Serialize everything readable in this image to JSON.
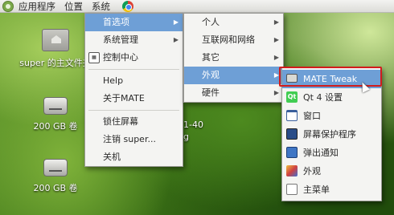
{
  "panel": {
    "menus": [
      "应用程序",
      "位置",
      "系统"
    ],
    "icons": {
      "logo": "mate-logo",
      "browser": "chrome-icon"
    }
  },
  "desktop": {
    "home_icon_label": "super 的主文件夹",
    "disk1_label": "200 GB 卷",
    "disk2_label": "200 GB 卷",
    "bg_fragment_1": "1-40",
    "bg_fragment_2": "g"
  },
  "system_menu": {
    "items": [
      {
        "label": "首选项",
        "has_submenu": true,
        "active": true
      },
      {
        "label": "系统管理",
        "has_submenu": true
      },
      {
        "label": "控制中心",
        "icon": "control-center-icon"
      },
      {
        "label": "Help"
      },
      {
        "label": "关于MATE"
      },
      {
        "label": "锁住屏幕"
      },
      {
        "label": "注销 super..."
      },
      {
        "label": "关机"
      }
    ]
  },
  "prefs_menu": {
    "items": [
      {
        "label": "个人",
        "has_submenu": true
      },
      {
        "label": "互联网和网络",
        "has_submenu": true
      },
      {
        "label": "其它",
        "has_submenu": true
      },
      {
        "label": "外观",
        "has_submenu": true,
        "active": true
      },
      {
        "label": "硬件",
        "has_submenu": true
      }
    ]
  },
  "appearance_menu": {
    "items": [
      {
        "label": "MATE Tweak",
        "icon": "mate-tweak-icon",
        "active": true
      },
      {
        "label": "Qt 4 设置",
        "icon": "qt-icon"
      },
      {
        "label": "窗口",
        "icon": "window-icon"
      },
      {
        "label": "屏幕保护程序",
        "icon": "screensaver-icon"
      },
      {
        "label": "弹出通知",
        "icon": "notification-icon"
      },
      {
        "label": "外观",
        "icon": "appearance-icon"
      },
      {
        "label": "主菜单",
        "icon": "main-menu-icon"
      }
    ]
  },
  "colors": {
    "highlight": "#6e9fd6",
    "annotation_box": "#d21c1c",
    "menu_bg": "#f4f4f2"
  }
}
